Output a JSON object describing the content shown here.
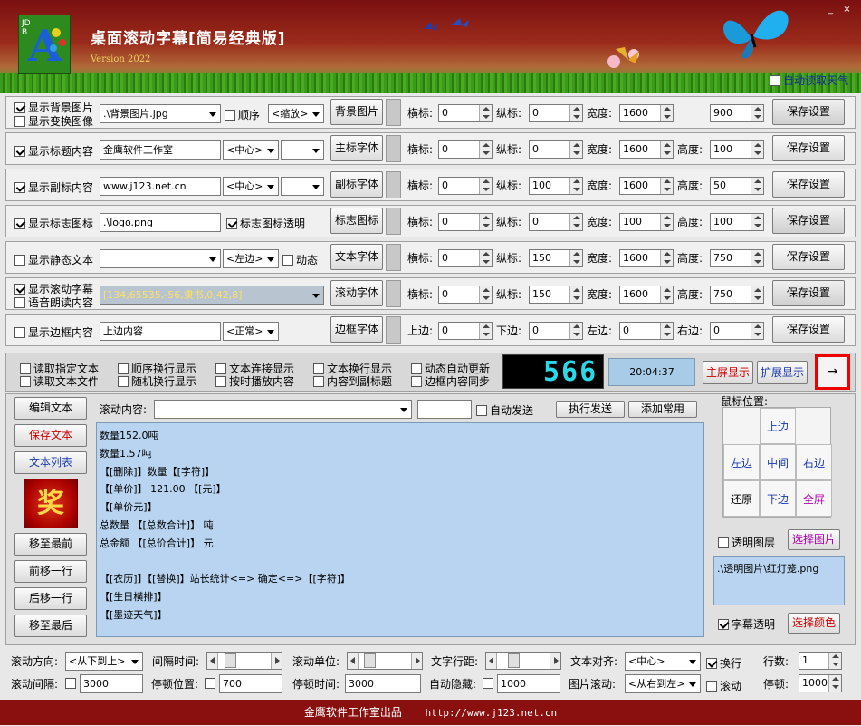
{
  "banner": {
    "title": "桌面滚动字幕[简易经典版]",
    "version": "Version 2022",
    "auto_weather": "自动读取天气",
    "logo_big": "A",
    "logo_small": "JDB"
  },
  "rows": [
    {
      "check1": "显示背景图片",
      "check2": "显示变换图像",
      "input": ".\\背景图片.jpg",
      "mid_check": "顺序",
      "dd": "<缩放>",
      "button": "背景图片",
      "x_label": "横标:",
      "x": "0",
      "y_label": "纵标:",
      "y": "0",
      "w_label": "宽度:",
      "w": "1600",
      "h_label": "",
      "h": "900",
      "save": "保存设置"
    },
    {
      "check1": "显示标题内容",
      "input": "金鹰软件工作室",
      "dd": "<中心>",
      "dd2": "",
      "button": "主标字体",
      "x_label": "横标:",
      "x": "0",
      "y_label": "纵标:",
      "y": "0",
      "w_label": "宽度:",
      "w": "1600",
      "h_label": "高度:",
      "h": "100",
      "save": "保存设置"
    },
    {
      "check1": "显示副标内容",
      "input": "www.j123.net.cn",
      "dd": "<中心>",
      "dd2": "",
      "button": "副标字体",
      "x_label": "横标:",
      "x": "0",
      "y_label": "纵标:",
      "y": "100",
      "w_label": "宽度:",
      "w": "1600",
      "h_label": "高度:",
      "h": "50",
      "save": "保存设置"
    },
    {
      "check1": "显示标志图标",
      "input": ".\\logo.png",
      "mid_check": "标志图标透明",
      "button": "标志图标",
      "x_label": "横标:",
      "x": "0",
      "y_label": "纵标:",
      "y": "0",
      "w_label": "宽度:",
      "w": "100",
      "h_label": "高度:",
      "h": "100",
      "save": "保存设置"
    },
    {
      "check1": "显示静态文本",
      "input": "",
      "dd": "<左边>",
      "mid_check": "动态",
      "button": "文本字体",
      "x_label": "横标:",
      "x": "0",
      "y_label": "纵标:",
      "y": "150",
      "w_label": "宽度:",
      "w": "1600",
      "h_label": "高度:",
      "h": "750",
      "save": "保存设置"
    },
    {
      "check1": "显示滚动字幕",
      "check2": "语音朗读内容",
      "input": "[134,65535,-56,隶书,0,42,8]",
      "button": "滚动字体",
      "x_label": "横标:",
      "x": "0",
      "y_label": "纵标:",
      "y": "150",
      "w_label": "宽度:",
      "w": "1600",
      "h_label": "高度:",
      "h": "750",
      "save": "保存设置"
    },
    {
      "check1": "显示边框内容",
      "input": "上边内容",
      "dd": "<正常>",
      "button": "边框字体",
      "x_label": "上边:",
      "x": "0",
      "y_label": "下边:",
      "y": "0",
      "w_label": "左边:",
      "w": "0",
      "h_label": "右边:",
      "h": "0",
      "save": "保存设置"
    }
  ],
  "options": [
    "读取指定文本",
    "读取文本文件",
    "顺序换行显示",
    "随机换行显示",
    "文本连接显示",
    "按时播放内容",
    "文本换行显示",
    "内容到副标题",
    "动态自动更新",
    "边框内容同步"
  ],
  "lcd": "566",
  "clock": "20:04:37",
  "main_display": "主屏显示",
  "ext_display": "扩展显示",
  "arrow": "→",
  "left_buttons": [
    "编辑文本",
    "保存文本",
    "文本列表",
    "移至最前",
    "前移一行",
    "后移一行",
    "移至最后"
  ],
  "prize": "奖",
  "scroll_label": "滚动内容:",
  "scroll_value": "",
  "auto_send": "自动发送",
  "exec_send": "执行发送",
  "add_common": "添加常用",
  "lines": [
    "数量152.0吨",
    "数量1.57吨",
    "【[删除]】数量【[字符]】",
    "【[单价]】 121.00 【[元]】",
    "【[单价元]】",
    "总数量 【[总数合计]】 吨",
    "总金额 【[总价合计]】 元",
    "",
    "【[农历]】【[替换]】站长统计<=> 确定<=>【[字符]】",
    "【[生日横排]】",
    "【[墨迹天气]】"
  ],
  "mouse": {
    "label": "鼠标位置:",
    "up": "上边",
    "left": "左边",
    "center": "中间",
    "right": "右边",
    "reset": "还原",
    "down": "下边",
    "full": "全屏"
  },
  "transparent_layer": "透明图层",
  "select_image": "选择图片",
  "image_path": ".\\透明图片\\红灯笼.png",
  "caption_transparent": "字幕透明",
  "select_color": "选择颜色",
  "bottom": {
    "dir_label": "滚动方向:",
    "dir": "<从下到上>",
    "interval_label": "间隔时间:",
    "unit_label": "滚动单位:",
    "spacing_label": "文字行距:",
    "align_label": "文本对齐:",
    "align": "<中心>",
    "wrap": "换行",
    "lines_label": "行数:",
    "lines_value": "1",
    "gap_label": "滚动间隔:",
    "gap": "3000",
    "stop_pos_label": "停顿位置:",
    "stop_pos": "700",
    "stop_time_label": "停顿时间:",
    "stop_time": "3000",
    "autohide_label": "自动隐藏:",
    "autohide": "1000",
    "img_scroll_label": "图片滚动:",
    "img_scroll": "<从右到左>",
    "scroll_check": "滚动",
    "pause_label": "停顿:",
    "pause": "1000",
    "slider_interval": 0.15,
    "slider_unit": 0.12,
    "slider_spacing": 0.25
  },
  "footer": {
    "left": "金鹰软件工作室出品",
    "right": "http://www.j123.net.cn"
  }
}
